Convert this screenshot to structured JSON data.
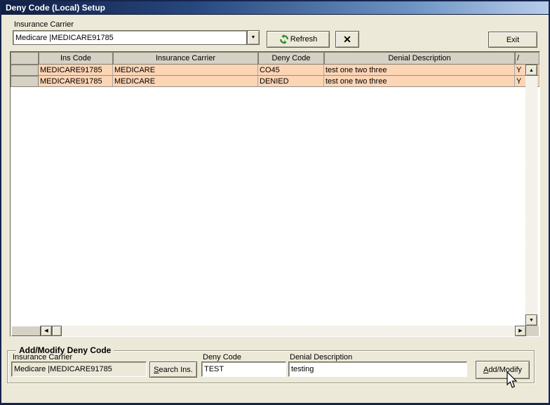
{
  "window": {
    "title": "Deny Code (Local) Setup"
  },
  "toolbar": {
    "insurance_carrier_label": "Insurance Carrier",
    "carrier_value": "Medicare |MEDICARE91785",
    "refresh_label": "Refresh",
    "clear_label": "✕",
    "exit_label": "Exit"
  },
  "grid": {
    "columns": [
      "",
      "Ins Code",
      "Insurance Carrier",
      "Deny Code",
      "Denial Description",
      "/"
    ],
    "rows": [
      {
        "cells": [
          "MEDICARE91785",
          "MEDICARE",
          "CO45",
          "test one two three",
          "Y"
        ]
      },
      {
        "cells": [
          "MEDICARE91785",
          "MEDICARE",
          "DENIED",
          "test one two three",
          "Y"
        ]
      }
    ]
  },
  "form": {
    "legend": "Add/Modify Deny Code",
    "insurance_carrier_label": "Insurance Carrier",
    "insurance_carrier_value": "Medicare |MEDICARE91785",
    "search_button": "Search Ins.",
    "deny_code_label": "Deny Code",
    "deny_code_value": "TEST",
    "denial_description_label": "Denial Description",
    "denial_description_value": "testing",
    "add_modify_button": "Add/Modify"
  },
  "icons": {
    "up": "▲",
    "down": "▼",
    "left": "◀",
    "right": "▶",
    "dropdown": "▼"
  },
  "colors": {
    "titlebar_start": "#101f45",
    "titlebar_end": "#b7cdea",
    "dialog_face": "#ece9d8",
    "row_highlight": "#fcd5b5",
    "header_face": "#d5d1c5",
    "refresh_green": "#2f8f2f"
  }
}
